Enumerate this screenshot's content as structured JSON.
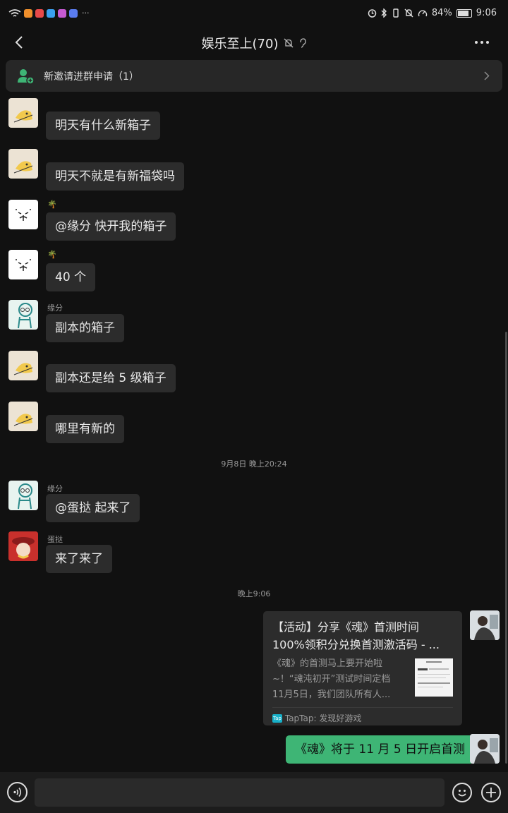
{
  "status_bar": {
    "battery": "84%",
    "time": "9:06",
    "more": "···",
    "app_icon_colors": [
      "#f0902c",
      "#e84a4a",
      "#3aa0f0",
      "#c65ad2",
      "#5a7cf0"
    ]
  },
  "header": {
    "title": "娱乐至上(70)",
    "mute_icon": "bell-off-icon",
    "ear_icon": "ear-icon",
    "more": "···"
  },
  "banner": {
    "label": "新邀请进群申请（1）"
  },
  "messages": [
    {
      "sender": "",
      "text": "明天有什么新箱子"
    },
    {
      "sender": "",
      "text": "明天不就是有新福袋吗"
    },
    {
      "sender": "🌴",
      "text": "@缘分  快开我的箱子"
    },
    {
      "sender": "🌴",
      "text": "40 个"
    },
    {
      "sender": "缘分",
      "text": "副本的箱子"
    },
    {
      "sender": "",
      "text": "副本还是给 5 级箱子"
    },
    {
      "sender": "",
      "text": "哪里有新的"
    },
    {
      "sender": "缘分",
      "text": "@蛋挞  起来了"
    },
    {
      "sender": "蛋挞",
      "text": "来了来了"
    }
  ],
  "timestamps": [
    "9月8日 晚上20:24",
    "晚上9:06"
  ],
  "link_card": {
    "title_line1": "【活动】分享《魂》首测时间",
    "title_line2": "100%领积分兑换首测激活码 - ...",
    "desc_line1": "《魂》的首测马上要开始啦",
    "desc_line2": "~！“魂沌初开”测试时间定档",
    "desc_line3": "11月5日，我们团队所有人...",
    "source_badge": "Tap",
    "source": "TapTap: 发现好游戏"
  },
  "my_message": "《魂》将于 11 月 5 日开启首测",
  "colors": {
    "background": "#111111",
    "bubble_other": "#2c2c2c",
    "bubble_self": "#3eb575",
    "banner_icon": "#3eb575"
  }
}
